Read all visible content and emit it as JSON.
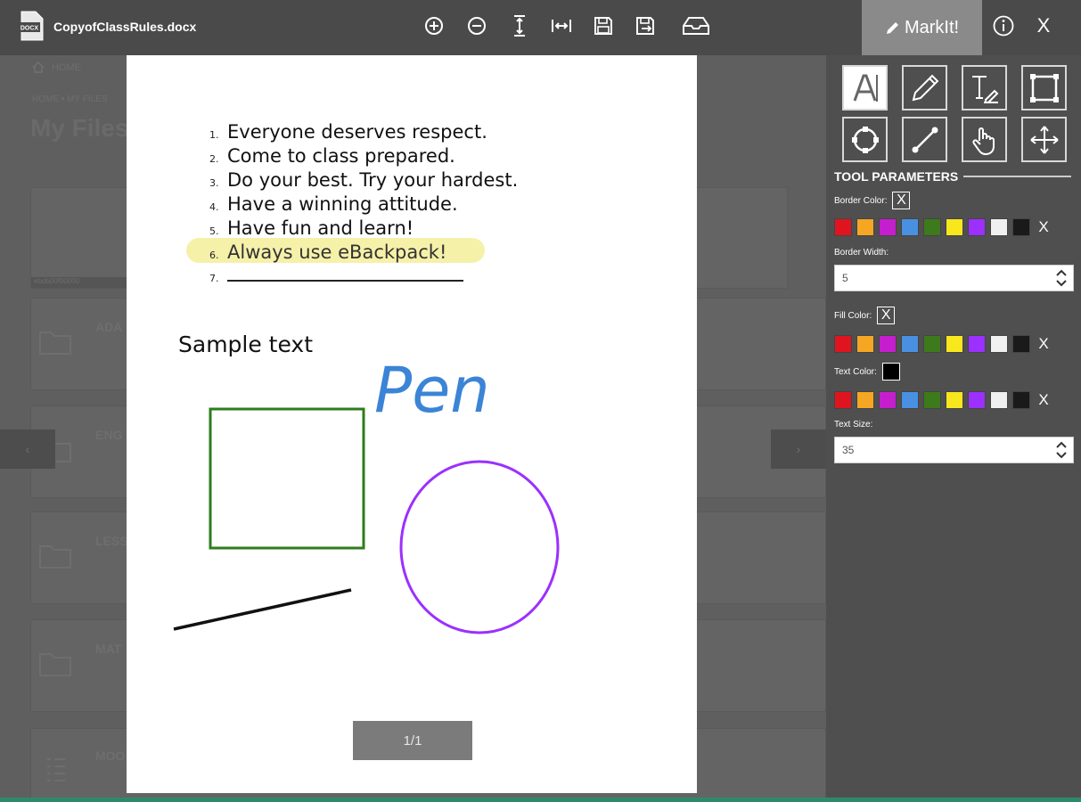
{
  "header": {
    "file_name": "CopyofClassRules.docx",
    "file_icon_text": "DOCX",
    "markit_label": "MarkIt!",
    "close_label": "X",
    "toolbar": [
      "zoom-in-icon",
      "zoom-out-icon",
      "fit-height-icon",
      "fit-width-icon",
      "save-icon",
      "save-as-icon",
      "inbox-icon"
    ]
  },
  "background": {
    "home_label": "HOME",
    "breadcrumb": "HOME • MY FILES",
    "title": "My Files",
    "card_caption": "ebdb00f90000",
    "rows": [
      "ADA",
      "ENG",
      "LESS",
      "MAT",
      "MOO"
    ],
    "prev_arrow": "‹",
    "next_arrow": "›"
  },
  "document": {
    "rules": [
      {
        "num": "1.",
        "text": "Everyone deserves respect."
      },
      {
        "num": "2.",
        "text": "Come to class prepared."
      },
      {
        "num": "3.",
        "text": "Do your best.  Try your hardest."
      },
      {
        "num": "4.",
        "text": "Have a winning attitude."
      },
      {
        "num": "5.",
        "text": "Have fun and learn!"
      },
      {
        "num": "6.",
        "text": "Always use eBackpack!"
      },
      {
        "num": "7.",
        "text": ""
      }
    ],
    "sample_text": "Sample text",
    "pen_text": "Pen",
    "page_counter": "1/1",
    "colors": {
      "highlight": "#f5ef9a",
      "rect": "#2e7d1e",
      "circle": "#9b30ff",
      "pen": "#3b84d6",
      "line": "#111111"
    }
  },
  "panel": {
    "tools": [
      "text-select-icon",
      "pencil-icon",
      "text-tool-icon",
      "rectangle-icon",
      "circle-icon",
      "line-icon",
      "hand-icon",
      "move-icon"
    ],
    "params_header": "TOOL PARAMETERS",
    "border_color_label": "Border Color:",
    "border_width_label": "Border Width:",
    "border_width_value": "5",
    "fill_color_label": "Fill Color:",
    "text_color_label": "Text Color:",
    "text_size_label": "Text Size:",
    "text_size_value": "35",
    "no_color_symbol": "X",
    "palette": [
      "#e0141e",
      "#f5a623",
      "#c51ecf",
      "#4a90e2",
      "#3c7a1c",
      "#f8e71c",
      "#9b30ff",
      "#f0f0f0",
      "#1a1a1a"
    ]
  },
  "accent": {
    "panel_bg": "#4f4f4f",
    "markit_bg": "#8a8a8a",
    "bottom_stripe": "#2f8a6b"
  }
}
